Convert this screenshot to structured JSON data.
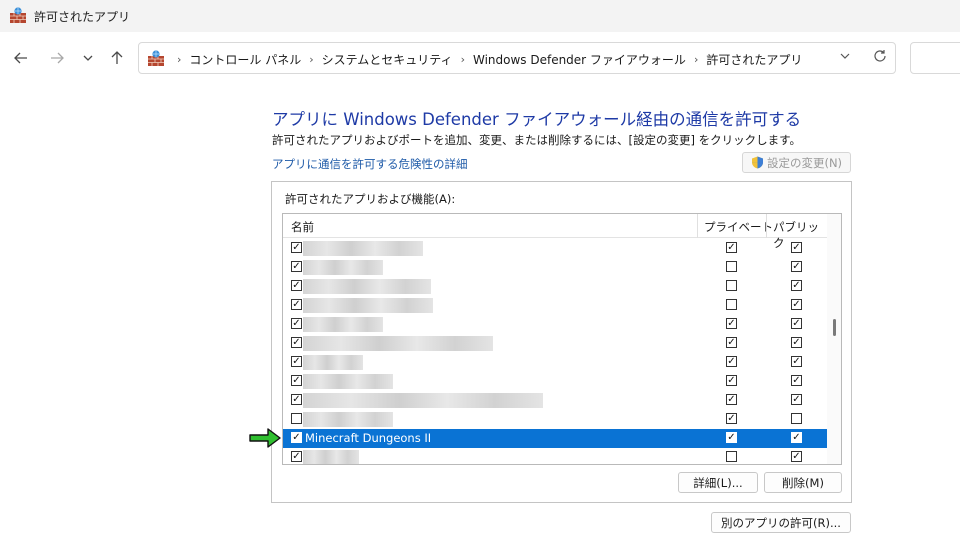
{
  "window": {
    "title": "許可されたアプリ"
  },
  "nav": {
    "back_icon": "arrow-left-icon",
    "forward_icon": "arrow-right-icon",
    "recent_icon": "chevron-down-icon",
    "up_icon": "arrow-up-icon",
    "breadcrumbs": [
      "コントロール パネル",
      "システムとセキュリティ",
      "Windows Defender ファイアウォール",
      "許可されたアプリ"
    ]
  },
  "main": {
    "heading": "アプリに Windows Defender ファイアウォール経由の通信を許可する",
    "description": "許可されたアプリおよびポートを追加、変更、または削除するには、[設定の変更] をクリックします。",
    "risk_link": "アプリに通信を許可する危険性の詳細",
    "change_settings_button": "設定の変更(N)",
    "group_label": "許可されたアプリおよび機能(A):",
    "columns": {
      "name": "名前",
      "private": "プライベート",
      "public": "パブリック"
    },
    "rows": [
      {
        "enabled": true,
        "name": "",
        "private": true,
        "public": true
      },
      {
        "enabled": true,
        "name": "",
        "private": false,
        "public": true
      },
      {
        "enabled": true,
        "name": "",
        "private": false,
        "public": true
      },
      {
        "enabled": true,
        "name": "",
        "private": false,
        "public": true
      },
      {
        "enabled": true,
        "name": "",
        "private": true,
        "public": true
      },
      {
        "enabled": true,
        "name": "",
        "private": true,
        "public": true
      },
      {
        "enabled": true,
        "name": "",
        "private": true,
        "public": true
      },
      {
        "enabled": true,
        "name": "",
        "private": true,
        "public": true
      },
      {
        "enabled": true,
        "name": "",
        "private": true,
        "public": true
      },
      {
        "enabled": false,
        "name": "",
        "private": true,
        "public": false
      },
      {
        "enabled": true,
        "name": "Minecraft Dungeons II",
        "private": true,
        "public": true,
        "selected": true
      },
      {
        "enabled": true,
        "name": "",
        "private": false,
        "public": true
      }
    ],
    "details_button": "詳細(L)...",
    "remove_button": "削除(M)",
    "allow_another_button": "別のアプリの許可(R)..."
  },
  "colors": {
    "selection": "#0a73d4",
    "link": "#1e5aa8",
    "heading": "#1e3aa6",
    "arrow": "#2fbf2f"
  }
}
